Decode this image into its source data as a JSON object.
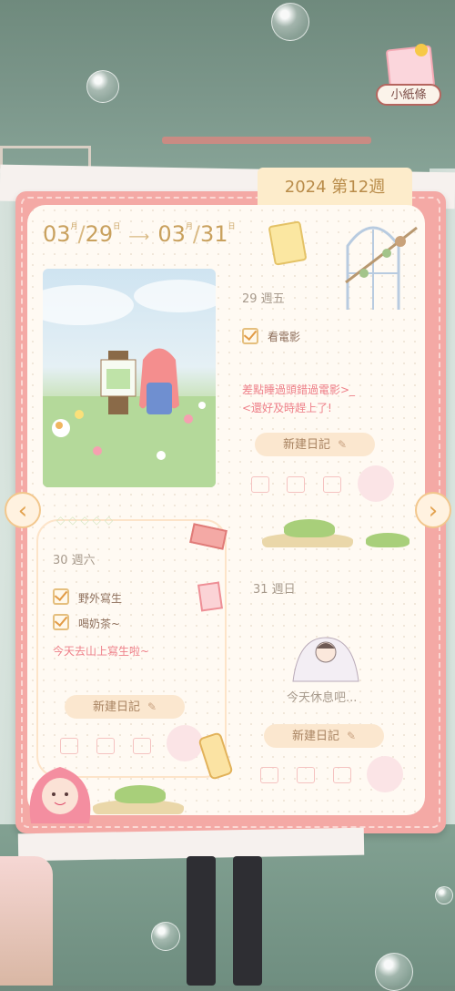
{
  "week_tab": {
    "label": "2024 第12週"
  },
  "date_range": {
    "start_month": "03",
    "start_month_unit": "月",
    "start_day": "29",
    "start_day_unit": "日",
    "end_month": "03",
    "end_month_unit": "月",
    "end_day": "31",
    "end_day_unit": "日"
  },
  "badge": {
    "label": "小紙條"
  },
  "days": [
    {
      "title": "29 週五",
      "tasks": [
        "看電影"
      ],
      "note_lines": [
        "差點睡過頭錯過電影>_",
        "<還好及時趕上了!"
      ],
      "new_entry_label": "新建日記"
    },
    {
      "title": "30 週六",
      "tasks": [
        "野外寫生",
        "喝奶茶~"
      ],
      "note_lines": [
        "今天去山上寫生啦~"
      ],
      "new_entry_label": "新建日記"
    },
    {
      "title": "31 週日",
      "rest_text": "今天休息吧...",
      "new_entry_label": "新建日記"
    }
  ],
  "nav": {
    "prev_icon": "‹",
    "next_icon": "›"
  },
  "colors": {
    "frame": "#f4a9a5",
    "page": "#fffaf3",
    "accent": "#e29b45",
    "note": "#ee7f88"
  }
}
